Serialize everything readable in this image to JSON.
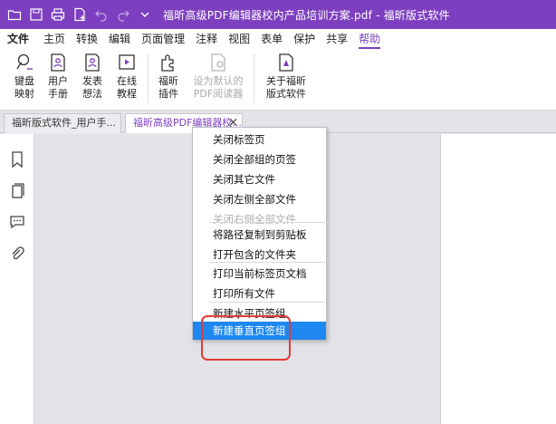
{
  "titlebar": {
    "title": "福昕高级PDF编辑器校内产品培训方案.pdf - 福昕版式软件",
    "quick_access": [
      "folder-icon",
      "save-icon",
      "print-icon",
      "new-doc-icon",
      "undo-icon",
      "redo-icon",
      "dropdown-icon"
    ]
  },
  "menubar": {
    "items": [
      "文件",
      "主页",
      "转换",
      "编辑",
      "页面管理",
      "注释",
      "视图",
      "表单",
      "保护",
      "共享",
      "帮助"
    ],
    "active": "帮助"
  },
  "ribbon": {
    "buttons": [
      {
        "line1": "键盘",
        "line2": "映射",
        "icon": "keyboard-map-icon",
        "enabled": true
      },
      {
        "line1": "用户",
        "line2": "手册",
        "icon": "user-manual-icon",
        "enabled": true
      },
      {
        "line1": "发表",
        "line2": "想法",
        "icon": "feedback-icon",
        "enabled": true
      },
      {
        "line1": "在线",
        "line2": "教程",
        "icon": "online-tutorial-icon",
        "enabled": true
      },
      {
        "line1": "福昕",
        "line2": "插件",
        "icon": "plugin-icon",
        "enabled": true
      },
      {
        "line1": "设为默认的",
        "line2": "PDF阅读器",
        "icon": "default-reader-icon",
        "enabled": false
      },
      {
        "line1": "关于福昕",
        "line2": "版式软件",
        "icon": "about-icon",
        "enabled": true
      }
    ]
  },
  "tabs": [
    {
      "label": "福昕版式软件_用户手...",
      "active": false
    },
    {
      "label": "福昕高级PDF编辑器校...",
      "active": true,
      "close": "×"
    }
  ],
  "sidebar": {
    "icons": [
      "bookmark-icon",
      "pages-icon",
      "comment-icon",
      "attachment-icon"
    ]
  },
  "context_menu": {
    "items": [
      {
        "label": "关闭标签页",
        "enabled": true
      },
      {
        "label": "关闭全部组的页签",
        "enabled": true
      },
      {
        "label": "关闭其它文件",
        "enabled": true
      },
      {
        "label": "关闭左侧全部文件",
        "enabled": true
      },
      {
        "label": "关闭右侧全部文件",
        "enabled": false
      },
      {
        "label": "将路径复制到剪贴板",
        "enabled": true
      },
      {
        "label": "打开包含的文件夹",
        "enabled": true
      },
      {
        "label": "打印当前标签页文档",
        "enabled": true
      },
      {
        "label": "打印所有文件",
        "enabled": true
      },
      {
        "label": "新建水平页签组",
        "enabled": true
      },
      {
        "label": "新建垂直页签组",
        "enabled": true,
        "selected": true
      }
    ]
  },
  "colors": {
    "accent": "#7d3fbf",
    "selection": "#1e88f0",
    "highlight": "#e53935"
  }
}
